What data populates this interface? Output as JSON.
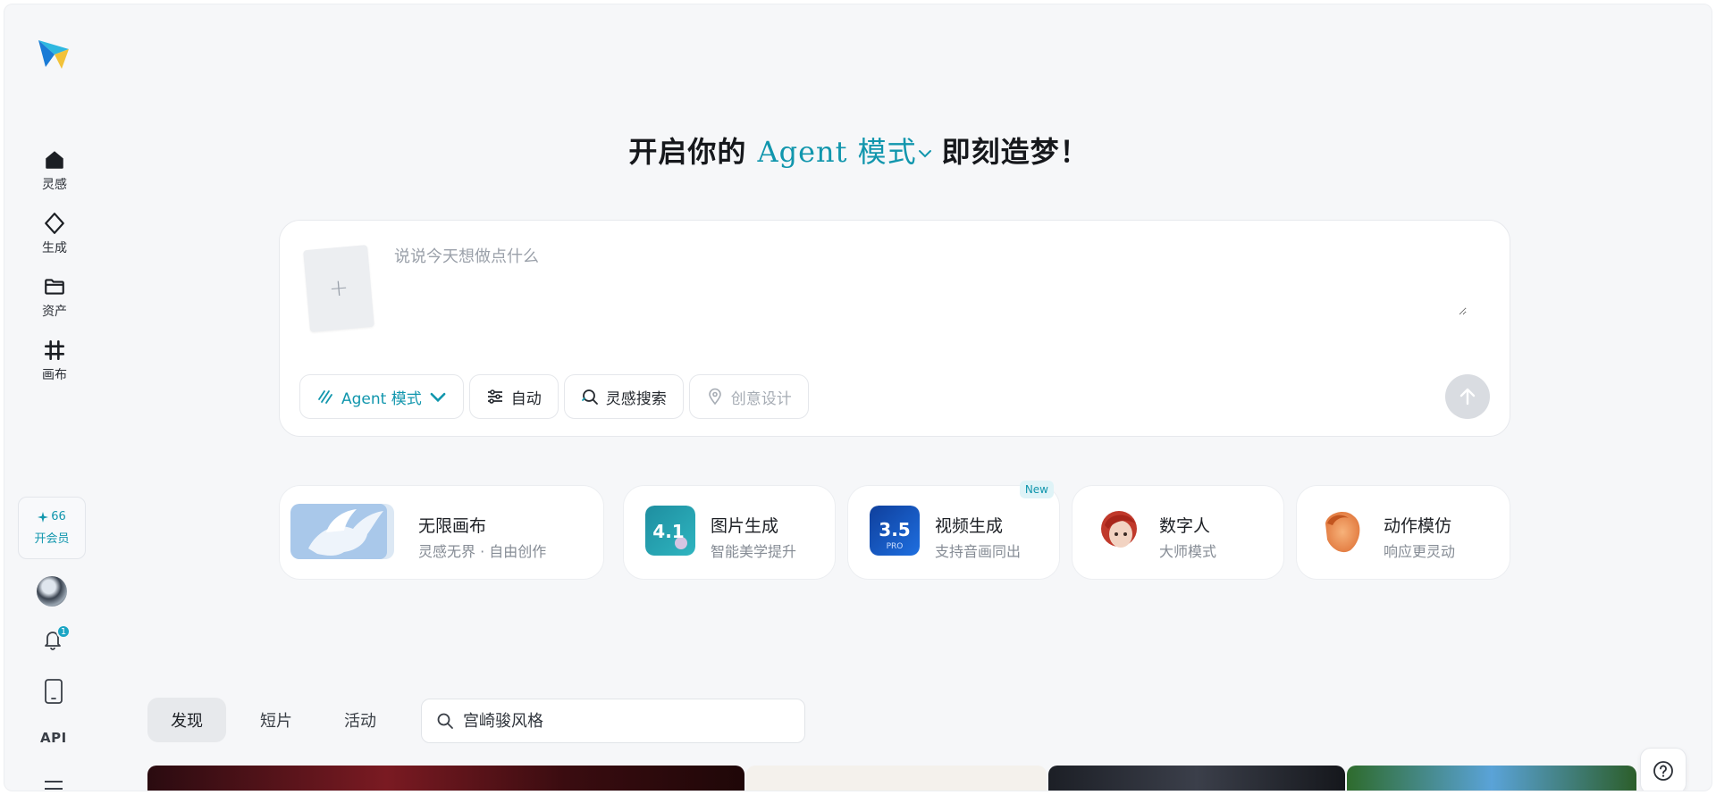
{
  "colors": {
    "accent": "#1196ad",
    "background": "#f6f7f9"
  },
  "sidebar": {
    "items": [
      {
        "label": "灵感",
        "icon": "home-icon"
      },
      {
        "label": "生成",
        "icon": "diamond-icon"
      },
      {
        "label": "资产",
        "icon": "folder-icon"
      },
      {
        "label": "画布",
        "icon": "hash-icon"
      }
    ],
    "member": {
      "points": "66",
      "cta": "开会员"
    },
    "notification_count": "1",
    "api_label": "API"
  },
  "headline": {
    "prefix": "开启你的",
    "mode": "Agent 模式",
    "suffix": "即刻造梦！"
  },
  "prompt": {
    "placeholder": "说说今天想做点什么",
    "upload_symbol": "+",
    "chips": {
      "agent": "Agent 模式",
      "auto": "自动",
      "search": "灵感搜索",
      "design": "创意设计"
    }
  },
  "features": [
    {
      "title": "无限画布",
      "subtitle": "灵感无界 · 自由创作"
    },
    {
      "title": "图片生成",
      "subtitle": "智能美学提升",
      "thumb_text": "4.1"
    },
    {
      "title": "视频生成",
      "subtitle": "支持音画同出",
      "thumb_text": "3.5",
      "thumb_sub": "PRO",
      "badge": "New"
    },
    {
      "title": "数字人",
      "subtitle": "大师模式"
    },
    {
      "title": "动作模仿",
      "subtitle": "响应更灵动"
    }
  ],
  "tabs": [
    "发现",
    "短片",
    "活动"
  ],
  "search": {
    "placeholder": "宫崎骏风格"
  }
}
